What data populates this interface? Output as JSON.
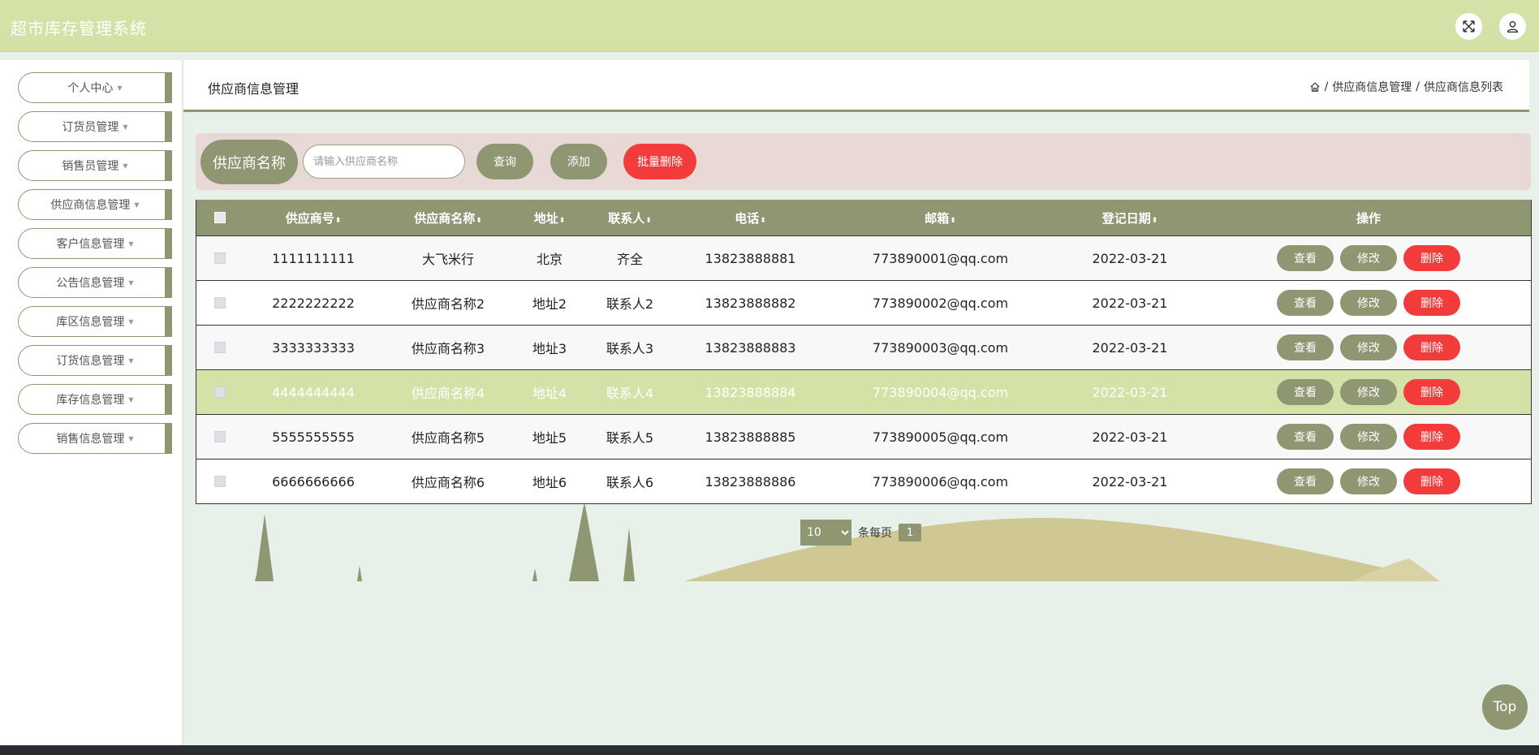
{
  "header": {
    "title": "超市库存管理系统",
    "fullscreen_icon": "expand-icon",
    "user_icon": "user-icon"
  },
  "sidebar": {
    "items": [
      {
        "label": "个人中心"
      },
      {
        "label": "订货员管理"
      },
      {
        "label": "销售员管理"
      },
      {
        "label": "供应商信息管理"
      },
      {
        "label": "客户信息管理"
      },
      {
        "label": "公告信息管理"
      },
      {
        "label": "库区信息管理"
      },
      {
        "label": "订货信息管理"
      },
      {
        "label": "库存信息管理"
      },
      {
        "label": "销售信息管理"
      }
    ],
    "caret": "▼"
  },
  "page": {
    "title": "供应商信息管理",
    "breadcrumb": [
      "供应商信息管理",
      "供应商信息列表"
    ],
    "separator": "/"
  },
  "search": {
    "label": "供应商名称",
    "placeholder": "请输入供应商名称",
    "query_label": "查询",
    "add_label": "添加",
    "batch_delete_label": "批量删除"
  },
  "table": {
    "columns": [
      "供应商号",
      "供应商名称",
      "地址",
      "联系人",
      "电话",
      "邮箱",
      "登记日期",
      "操作"
    ],
    "sort_glyph": "⬍",
    "rows": [
      {
        "id": "1111111111",
        "name": "大飞米行",
        "addr": "北京",
        "contact": "齐全",
        "phone": "13823888881",
        "email": "773890001@qq.com",
        "date": "2022-03-21"
      },
      {
        "id": "2222222222",
        "name": "供应商名称2",
        "addr": "地址2",
        "contact": "联系人2",
        "phone": "13823888882",
        "email": "773890002@qq.com",
        "date": "2022-03-21"
      },
      {
        "id": "3333333333",
        "name": "供应商名称3",
        "addr": "地址3",
        "contact": "联系人3",
        "phone": "13823888883",
        "email": "773890003@qq.com",
        "date": "2022-03-21"
      },
      {
        "id": "4444444444",
        "name": "供应商名称4",
        "addr": "地址4",
        "contact": "联系人4",
        "phone": "13823888884",
        "email": "773890004@qq.com",
        "date": "2022-03-21"
      },
      {
        "id": "5555555555",
        "name": "供应商名称5",
        "addr": "地址5",
        "contact": "联系人5",
        "phone": "13823888885",
        "email": "773890005@qq.com",
        "date": "2022-03-21"
      },
      {
        "id": "6666666666",
        "name": "供应商名称6",
        "addr": "地址6",
        "contact": "联系人6",
        "phone": "13823888886",
        "email": "773890006@qq.com",
        "date": "2022-03-21"
      }
    ],
    "actions": {
      "view": "查看",
      "edit": "修改",
      "delete": "删除"
    }
  },
  "pagination": {
    "page_size": "10",
    "per_page_label": "条每页",
    "current_page": "1"
  },
  "back_to_top": "Top",
  "colors": {
    "header_bg": "#d4e2a8",
    "accent": "#8e9672",
    "danger": "#f23c3c",
    "highlight_row": "#d4e2a8",
    "search_bg": "#e8d8d6"
  }
}
